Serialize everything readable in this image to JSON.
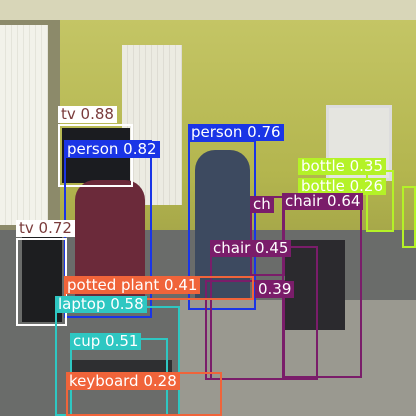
{
  "image": {
    "description_colors": {
      "wall": "#b8bb52",
      "ceiling": "#d9d7b6",
      "floor": "#8f8e86",
      "blinds": "#e8e8df"
    }
  },
  "detections": [
    {
      "label": "tv 0.88",
      "color": "#ffffff",
      "text_color": "#7a3b3b"
    },
    {
      "label": "person 0.82",
      "color": "#1a35e6",
      "text_color": "#ffffff"
    },
    {
      "label": "person 0.76",
      "color": "#1a35e6",
      "text_color": "#ffffff"
    },
    {
      "label": "bottle 0.35",
      "color": "#b4f227",
      "text_color": "#ffffff"
    },
    {
      "label": "bottle 0.26",
      "color": "#b4f227",
      "text_color": "#ffffff"
    },
    {
      "label": "chair 0.64",
      "color": "#7a1d6a",
      "text_color": "#ffffff"
    },
    {
      "label": "ch",
      "color": "#7a1d6a",
      "text_color": "#ffffff"
    },
    {
      "label": "chair 0.45",
      "color": "#7a1d6a",
      "text_color": "#ffffff"
    },
    {
      "label": "0.39",
      "color": "#7a1d6a",
      "text_color": "#ffffff"
    },
    {
      "label": "tv 0.72",
      "color": "#ffffff",
      "text_color": "#7a3b3b"
    },
    {
      "label": "potted plant 0.41",
      "color": "#f0643a",
      "text_color": "#ffffff"
    },
    {
      "label": "laptop 0.58",
      "color": "#2ec7c2",
      "text_color": "#ffffff"
    },
    {
      "label": "cup 0.51",
      "color": "#2ec7c2",
      "text_color": "#ffffff"
    },
    {
      "label": "keyboard 0.28",
      "color": "#f0643a",
      "text_color": "#ffffff"
    }
  ]
}
